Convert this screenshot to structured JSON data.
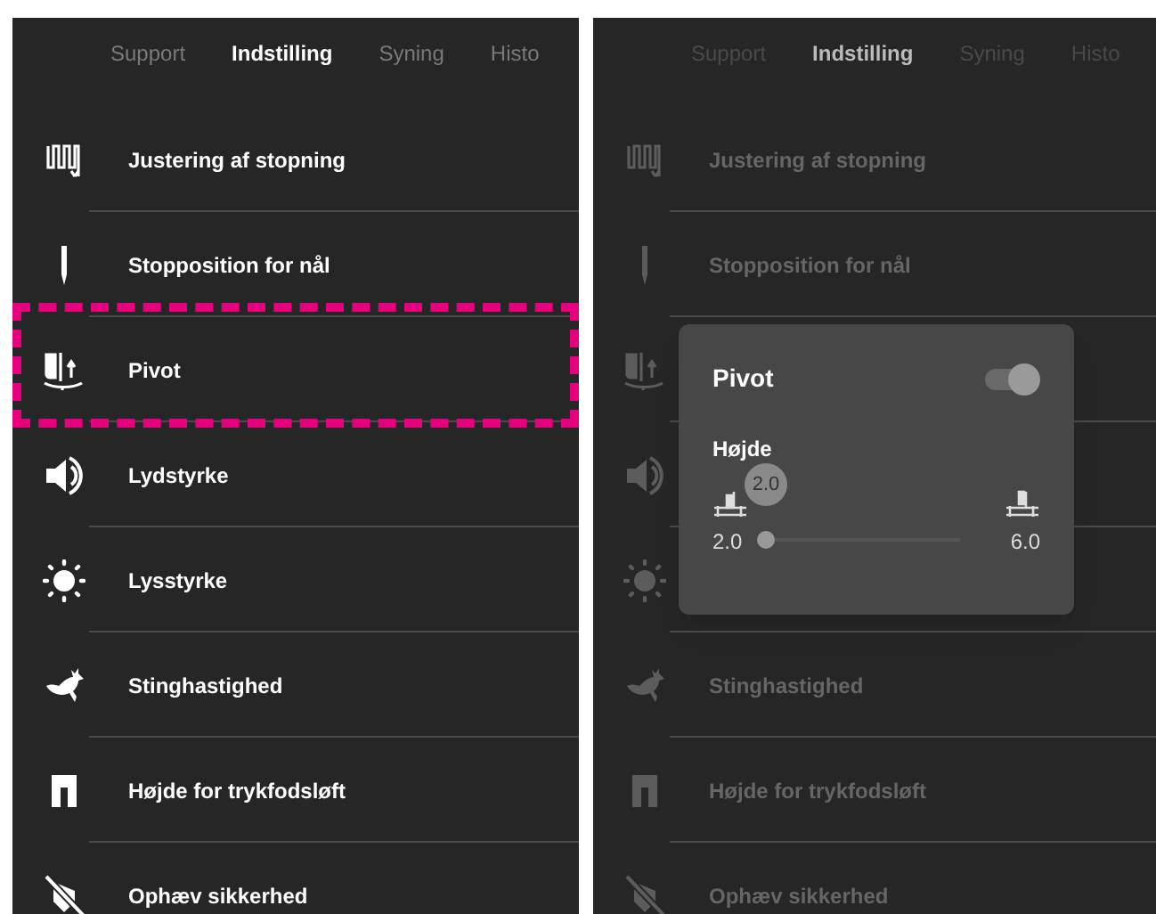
{
  "screens": [
    {
      "dimmed": false,
      "tabs": [
        {
          "label": "Support",
          "selected": false
        },
        {
          "label": "Indstilling",
          "selected": true
        },
        {
          "label": "Syning",
          "selected": false
        },
        {
          "label": "Histo",
          "selected": false
        }
      ],
      "items": [
        {
          "label": "Justering af stopning",
          "highlighted": false
        },
        {
          "label": "Stopposition for nål",
          "highlighted": false
        },
        {
          "label": "Pivot",
          "highlighted": true
        },
        {
          "label": "Lydstyrke",
          "highlighted": false
        },
        {
          "label": "Lysstyrke",
          "highlighted": false
        },
        {
          "label": "Stinghastighed",
          "highlighted": false
        },
        {
          "label": "Højde for trykfodsløft",
          "highlighted": false
        },
        {
          "label": "Ophæv sikkerhed",
          "highlighted": false
        }
      ]
    },
    {
      "dimmed": true,
      "tabs": [
        {
          "label": "Support",
          "selected": false
        },
        {
          "label": "Indstilling",
          "selected": true
        },
        {
          "label": "Syning",
          "selected": false
        },
        {
          "label": "Histo",
          "selected": false
        }
      ],
      "items": [
        {
          "kind": "labelled",
          "label": "Justering af stopning"
        },
        {
          "kind": "labelled",
          "label": "Stopposition for nål"
        },
        {
          "kind": "icon_only"
        },
        {
          "kind": "icon_only"
        },
        {
          "kind": "icon_only"
        },
        {
          "kind": "labelled",
          "label": "Stinghastighed"
        },
        {
          "kind": "labelled",
          "label": "Højde for trykfodsløft"
        },
        {
          "kind": "labelled",
          "label": "Ophæv sikkerhed"
        }
      ],
      "popup": {
        "title": "Pivot",
        "toggle": {
          "on": true
        },
        "label": "Højde",
        "bubble": "2.0",
        "min": "2.0",
        "max": "6.0",
        "level": 0
      }
    }
  ]
}
